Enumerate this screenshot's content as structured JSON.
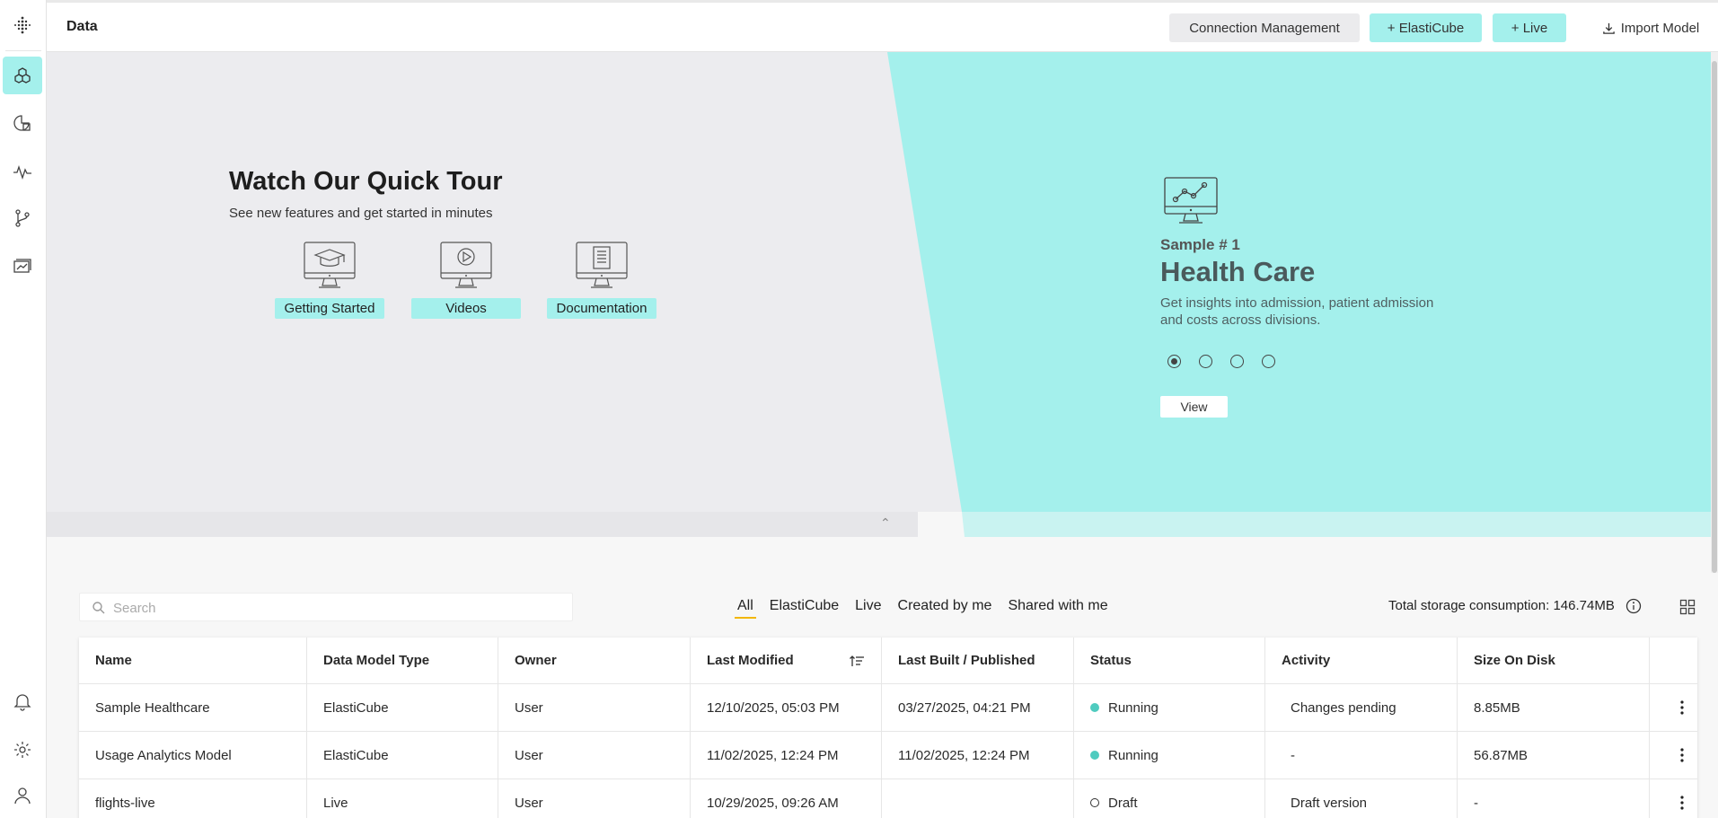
{
  "header": {
    "title": "Data",
    "buttons": {
      "connection_management": "Connection Management",
      "elasticube": "+ ElastiCube",
      "live": "+ Live",
      "import_model": "Import Model"
    }
  },
  "hero": {
    "tour_title": "Watch Our Quick Tour",
    "tour_subtitle": "See new features and get started in minutes",
    "tiles": [
      {
        "label": "Getting Started",
        "icon": "graduation-cap-monitor-icon"
      },
      {
        "label": "Videos",
        "icon": "play-monitor-icon"
      },
      {
        "label": "Documentation",
        "icon": "document-monitor-icon"
      }
    ],
    "sample": {
      "number": "Sample # 1",
      "title": "Health Care",
      "description": "Get insights into admission, patient admission and costs across divisions.",
      "view_label": "View",
      "active_slide": 1,
      "slide_count": 4
    },
    "colors": {
      "teal": "#a4f0ec",
      "grey": "#ececef"
    }
  },
  "filters": {
    "search_placeholder": "Search",
    "tabs": [
      "All",
      "ElastiCube",
      "Live",
      "Created by me",
      "Shared with me"
    ],
    "active_tab": "All",
    "storage_label": "Total storage consumption:",
    "storage_value": "146.74MB"
  },
  "table": {
    "columns": [
      "Name",
      "Data Model Type",
      "Owner",
      "Last Modified",
      "Last Built / Published",
      "Status",
      "Activity",
      "Size On Disk"
    ],
    "rows": [
      {
        "name": "Sample Healthcare",
        "type": "ElastiCube",
        "owner": "User",
        "modified": "12/10/2025, 05:03 PM",
        "built": "03/27/2025, 04:21 PM",
        "status": "Running",
        "activity": "Changes pending",
        "size": "8.85MB"
      },
      {
        "name": "Usage Analytics Model",
        "type": "ElastiCube",
        "owner": "User",
        "modified": "11/02/2025, 12:24 PM",
        "built": "11/02/2025, 12:24 PM",
        "status": "Running",
        "activity": "-",
        "size": "56.87MB"
      },
      {
        "name": "flights-live",
        "type": "Live",
        "owner": "User",
        "modified": "10/29/2025, 09:26 AM",
        "built": "",
        "status": "Draft",
        "activity": "Draft version",
        "size": "-"
      }
    ]
  }
}
